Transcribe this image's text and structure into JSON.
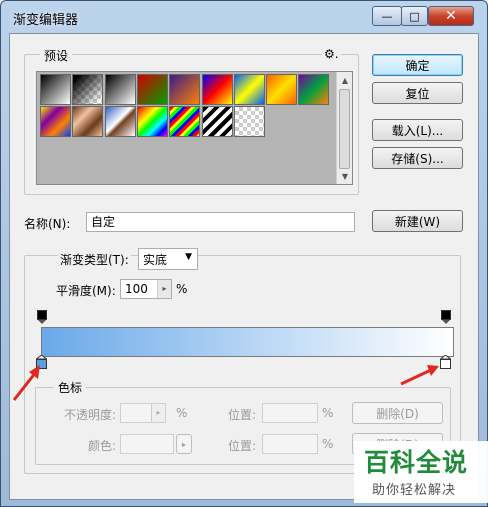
{
  "window": {
    "title": "渐变编辑器"
  },
  "titlebar_buttons": {
    "minimize": "—",
    "maximize": "□",
    "close": "✕"
  },
  "presets": {
    "legend": "预设",
    "gear": "⚙.",
    "row1_swatches": [
      {
        "name": "fg-to-bg",
        "css": "linear-gradient(135deg,#000,#fff)"
      },
      {
        "name": "fg-to-transparent",
        "css": "linear-gradient(135deg,#000 10%,rgba(0,0,0,0) 90%),repeating-conic-gradient(#ccc 0 25%,#fff 0 50%) 0 0/8px 8px"
      },
      {
        "name": "black-white",
        "css": "linear-gradient(135deg,#000,#fff)"
      },
      {
        "name": "red-green",
        "css": "linear-gradient(135deg,#d00000,#00a000)"
      },
      {
        "name": "violet-orange",
        "css": "linear-gradient(135deg,#3a1c8a,#ff8000)"
      },
      {
        "name": "blue-red-yellow",
        "css": "linear-gradient(135deg,#0000ff,#ff0000,#ffff00)"
      },
      {
        "name": "blue-yellow-blue",
        "css": "linear-gradient(135deg,#0060ff,#ffff00,#0060ff)"
      },
      {
        "name": "orange-yellow-orange",
        "css": "linear-gradient(135deg,#ff6000,#ffe000,#ff6000)"
      },
      {
        "name": "violet-green-orange",
        "css": "linear-gradient(135deg,#7a00a0,#00a040,#ff8000)"
      }
    ],
    "row2_swatches": [
      {
        "name": "yellow-violet-orange-blue",
        "css": "linear-gradient(135deg,#ffe000,#8000a0,#ff8000,#0040ff)"
      },
      {
        "name": "copper",
        "css": "linear-gradient(135deg,#6a3a1a,#f0c0a0,#6a3a1a,#f0c0a0)"
      },
      {
        "name": "chrome",
        "css": "linear-gradient(135deg,#3060c0,#fff 45%,#704020 55%,#fff)"
      },
      {
        "name": "spectrum",
        "css": "linear-gradient(135deg,#ff0000,#ff8000,#ffff00,#00ff00,#00ffff,#0000ff,#ff00ff)"
      },
      {
        "name": "transparent-rainbow",
        "css": "repeating-linear-gradient(135deg,#ff0000 0 3px,#ffff00 3px 6px,#00ff00 6px 9px,#0000ff 9px 12px)"
      },
      {
        "name": "transparent-stripes",
        "css": "repeating-linear-gradient(135deg,#000 0 4px,#fff 4px 8px)"
      },
      {
        "name": "checker-transparent",
        "css": "repeating-conic-gradient(#ccc 0 25%,#fff 0 50%) 0 0/8px 8px"
      }
    ]
  },
  "buttons": {
    "ok": "确定",
    "reset": "复位",
    "load": "载入(L)...",
    "save": "存储(S)...",
    "new": "新建(W)"
  },
  "name_row": {
    "label": "名称(N):",
    "value": "自定"
  },
  "gradient_type": {
    "label": "渐变类型(T):",
    "value": "实底"
  },
  "smoothness": {
    "label": "平滑度(M):",
    "value": "100",
    "unit": "%"
  },
  "gradient": {
    "start_color": "#6aa9e9",
    "end_color": "#ffffff"
  },
  "stops": {
    "legend": "色标",
    "opacity_label": "不透明度:",
    "opacity_unit": "%",
    "location_label_1": "位置:",
    "location_unit_1": "%",
    "delete_1": "删除(D)",
    "color_label": "颜色:",
    "location_label_2": "位置:",
    "location_unit_2": "%",
    "delete_2": "删除(D)"
  },
  "watermark": {
    "big": "百科全说",
    "small": "助你轻松解决"
  },
  "colors": {
    "arrow": "#e0281e",
    "selected_stop": "#5b9fe0"
  }
}
